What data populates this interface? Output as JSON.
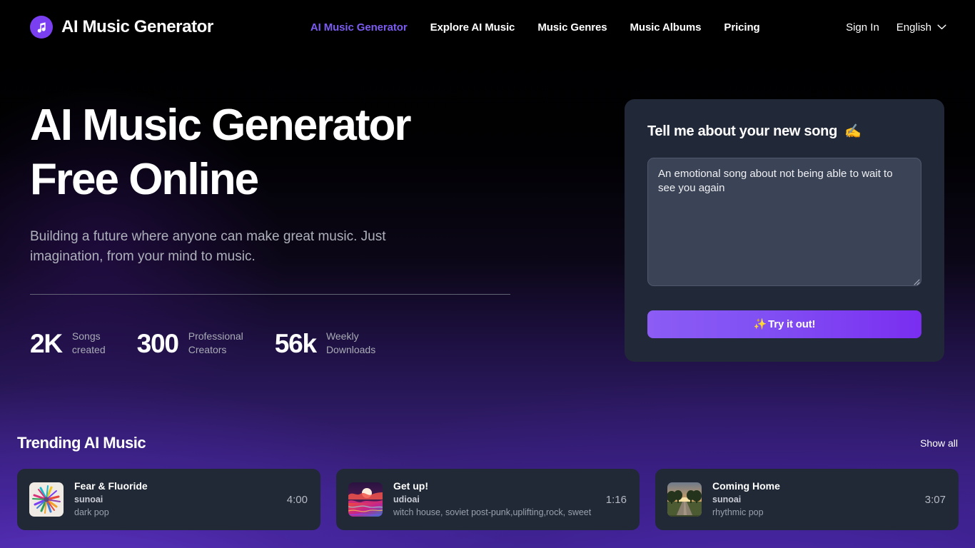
{
  "header": {
    "brand": {
      "name": "AI Music Generator",
      "logo_icon": "music-note-icon",
      "logo_color": "#7b3ff2"
    },
    "nav": [
      {
        "label": "AI Music Generator",
        "active": true
      },
      {
        "label": "Explore AI Music",
        "active": false
      },
      {
        "label": "Music Genres",
        "active": false
      },
      {
        "label": "Music Albums",
        "active": false
      },
      {
        "label": "Pricing",
        "active": false
      }
    ],
    "sign_in": "Sign In",
    "language": "English",
    "chevron_icon": "chevron-down-icon",
    "active_color": "#7c5cf0"
  },
  "hero": {
    "title_line1": "AI Music Generator",
    "title_line2": "Free Online",
    "subtitle": "Building a future where anyone can make great music. Just imagination, from your mind to music.",
    "stats": [
      {
        "value": "2K",
        "label": "Songs\ncreated"
      },
      {
        "value": "300",
        "label": "Professional\nCreators"
      },
      {
        "value": "56k",
        "label": "Weekly\nDownloads"
      }
    ]
  },
  "panel": {
    "title": "Tell me about your new song",
    "title_emoji": "✍️",
    "prompt_value": "An emotional song about not being able to wait to see you again",
    "prompt_placeholder": "An emotional song about not being able to wait to see you again",
    "button_label": "Try it out!",
    "button_emoji": "✨",
    "button_color": "#7a2ef0",
    "panel_color": "#212838"
  },
  "trending": {
    "title": "Trending AI Music",
    "show_all": "Show all",
    "cards": [
      {
        "title": "Fear & Fluoride",
        "artist": "sunoai",
        "tags": "dark pop",
        "duration": "4:00",
        "thumb": "colorful-burst-thumbnail"
      },
      {
        "title": "Get up!",
        "artist": "udioai",
        "tags": "witch house, soviet post-punk,uplifting,rock, sweet",
        "duration": "1:16",
        "thumb": "sunset-moon-thumbnail"
      },
      {
        "title": "Coming Home",
        "artist": "sunoai",
        "tags": "rhythmic pop",
        "duration": "3:07",
        "thumb": "country-road-sunset-thumbnail"
      }
    ]
  }
}
